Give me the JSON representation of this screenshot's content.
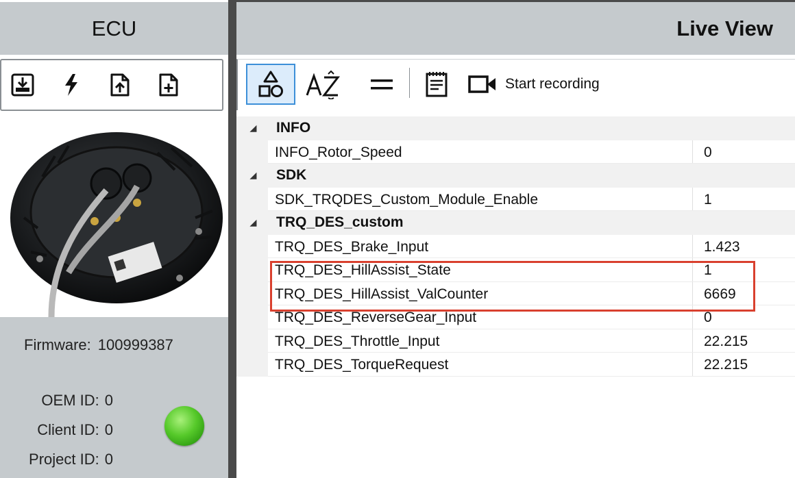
{
  "ecu_panel": {
    "title": "ECU",
    "toolbar": [
      {
        "icon": "download-box-icon"
      },
      {
        "icon": "flash-icon"
      },
      {
        "icon": "file-upload-icon"
      },
      {
        "icon": "file-add-icon"
      }
    ],
    "firmware_label": "Firmware:",
    "firmware_value": "100999387",
    "oem_label": "OEM ID:",
    "oem_value": "0",
    "client_label": "Client ID:",
    "client_value": "0",
    "project_label": "Project ID:",
    "project_value": "0",
    "status_led_color": "#56c92a"
  },
  "live_view": {
    "title": "Live View",
    "toolbar": {
      "buttons": [
        {
          "icon": "sort-categorized-icon",
          "active": true
        },
        {
          "icon": "sort-alphabetical-icon",
          "active": false
        },
        {
          "icon": "equal-icon",
          "active": false
        },
        {
          "icon": "notes-icon",
          "active": false
        }
      ],
      "record_icon": "video-camera-icon",
      "record_label": "Start recording"
    },
    "categories": [
      {
        "name": "INFO",
        "rows": [
          {
            "name": "INFO_Rotor_Speed",
            "value": "0"
          }
        ]
      },
      {
        "name": "SDK",
        "rows": [
          {
            "name": "SDK_TRQDES_Custom_Module_Enable",
            "value": "1"
          }
        ]
      },
      {
        "name": "TRQ_DES_custom",
        "rows": [
          {
            "name": "TRQ_DES_Brake_Input",
            "value": "1.423"
          },
          {
            "name": "TRQ_DES_HillAssist_State",
            "value": "1"
          },
          {
            "name": "TRQ_DES_HillAssist_ValCounter",
            "value": "6669"
          },
          {
            "name": "TRQ_DES_ReverseGear_Input",
            "value": "0"
          },
          {
            "name": "TRQ_DES_Throttle_Input",
            "value": "22.215"
          },
          {
            "name": "TRQ_DES_TorqueRequest",
            "value": "22.215"
          }
        ]
      }
    ],
    "highlight_color": "#d9402e"
  }
}
